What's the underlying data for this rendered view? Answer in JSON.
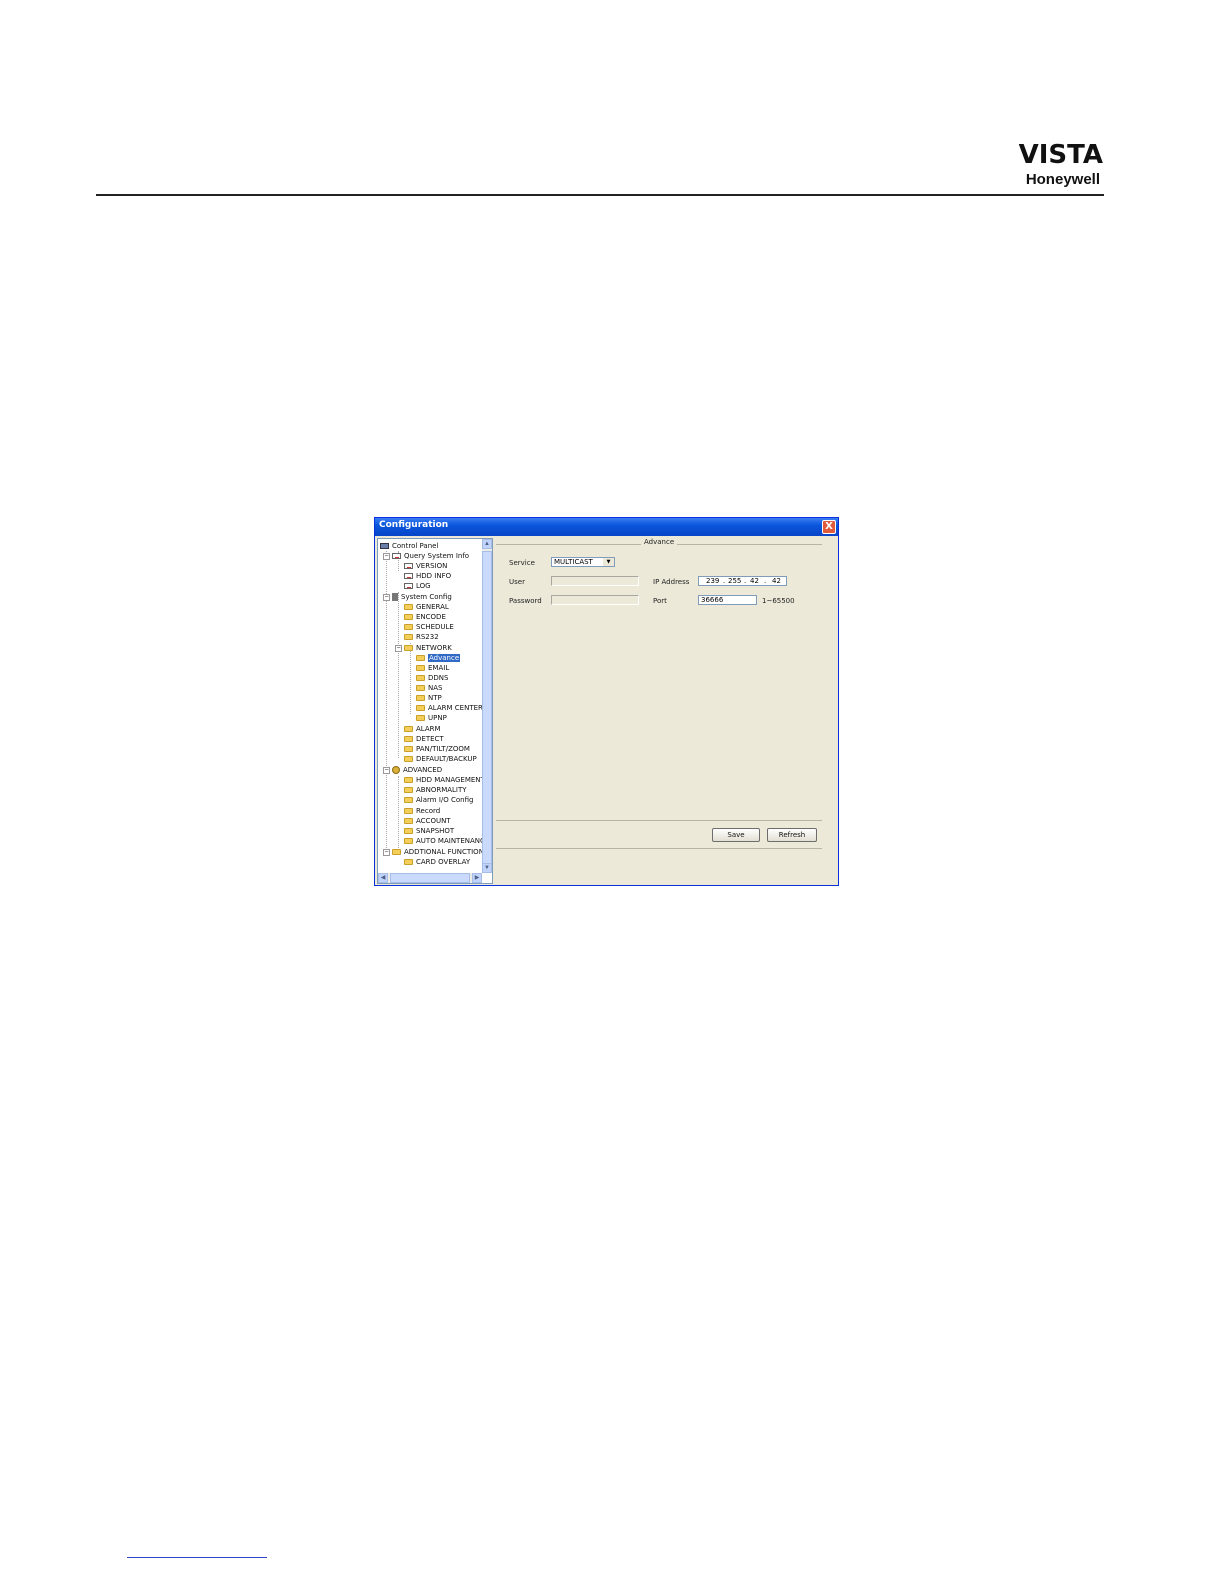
{
  "brand": {
    "name": "VISTA",
    "maker": "Honeywell"
  },
  "window": {
    "title": "Configuration",
    "close_label": "X"
  },
  "tree": {
    "items": [
      {
        "label": "Control Panel"
      },
      {
        "label": "Query System Info"
      },
      {
        "label": "VERSION"
      },
      {
        "label": "HDD INFO"
      },
      {
        "label": "LOG"
      },
      {
        "label": "System Config"
      },
      {
        "label": "GENERAL"
      },
      {
        "label": "ENCODE"
      },
      {
        "label": "SCHEDULE"
      },
      {
        "label": "RS232"
      },
      {
        "label": "NETWORK"
      },
      {
        "label": "Advance"
      },
      {
        "label": "EMAIL"
      },
      {
        "label": "DDNS"
      },
      {
        "label": "NAS"
      },
      {
        "label": "NTP"
      },
      {
        "label": "ALARM CENTER"
      },
      {
        "label": "UPNP"
      },
      {
        "label": "ALARM"
      },
      {
        "label": "DETECT"
      },
      {
        "label": "PAN/TILT/ZOOM"
      },
      {
        "label": "DEFAULT/BACKUP"
      },
      {
        "label": "ADVANCED"
      },
      {
        "label": "HDD MANAGEMENT"
      },
      {
        "label": "ABNORMALITY"
      },
      {
        "label": "Alarm I/O Config"
      },
      {
        "label": "Record"
      },
      {
        "label": "ACCOUNT"
      },
      {
        "label": "SNAPSHOT"
      },
      {
        "label": "AUTO MAINTENANC"
      },
      {
        "label": "ADDTIONAL FUNCTION"
      },
      {
        "label": "CARD OVERLAY"
      }
    ],
    "selected": "Advance"
  },
  "advance": {
    "group_title": "Advance",
    "service_label": "Service",
    "service_value": "MULTICAST",
    "user_label": "User",
    "password_label": "Password",
    "ip_label": "IP Address",
    "ip": [
      "239",
      "255",
      "42",
      "42"
    ],
    "port_label": "Port",
    "port_value": "36666",
    "port_range": "1~65500",
    "save_label": "Save",
    "refresh_label": "Refresh"
  }
}
